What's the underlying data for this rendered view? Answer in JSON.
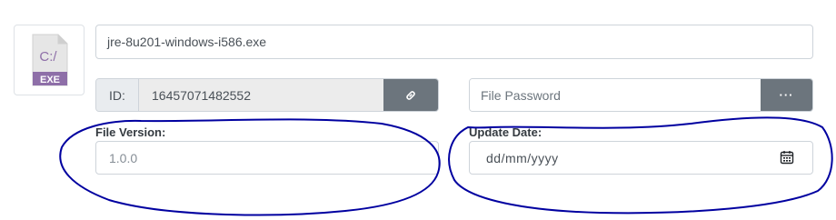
{
  "file": {
    "icon_label": "C:/",
    "icon_ext": "EXE",
    "name": "jre-8u201-windows-i586.exe"
  },
  "id": {
    "label": "ID:",
    "value": "16457071482552",
    "link_icon": "link-icon"
  },
  "password": {
    "placeholder": "File Password",
    "button_label": "···"
  },
  "version": {
    "label": "File Version:",
    "placeholder": "1.0.0"
  },
  "update_date": {
    "label": "Update Date:",
    "placeholder": "dd/mm/yyyy",
    "icon": "calendar-icon"
  },
  "colors": {
    "button_gray": "#6c757d",
    "border": "#ced4da",
    "annotation_ink": "#0000a0",
    "exe_badge": "#8e6fa8"
  }
}
